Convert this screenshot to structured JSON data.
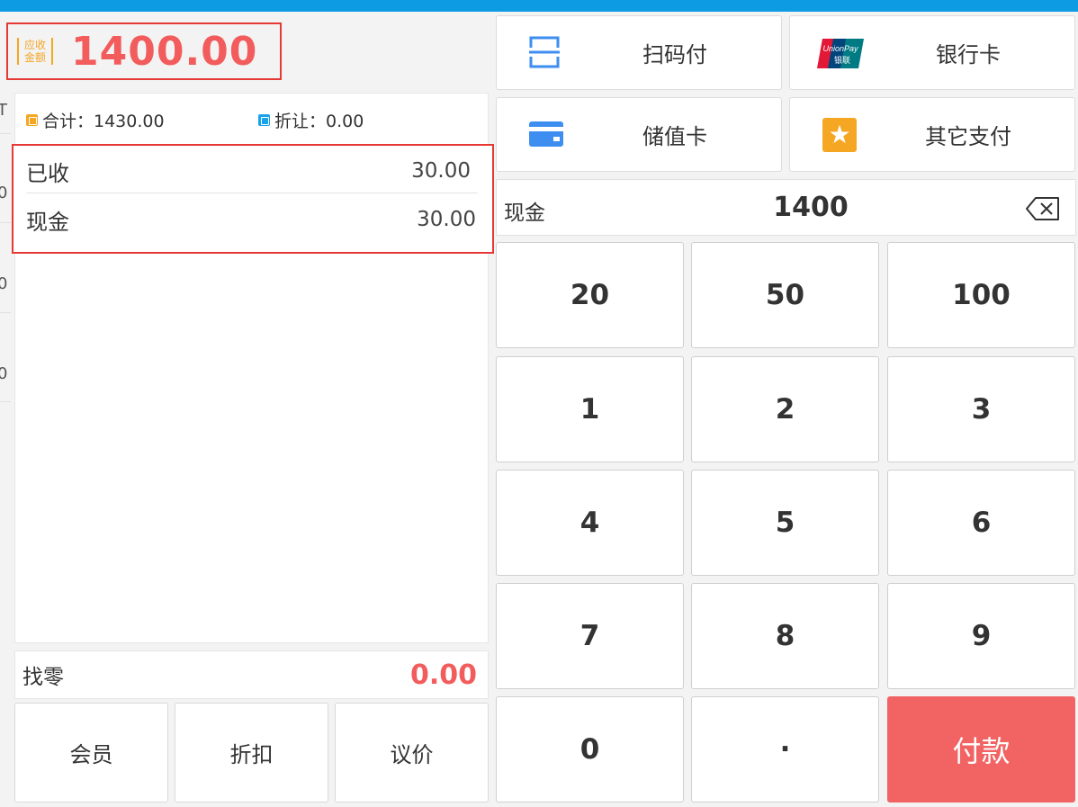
{
  "colors": {
    "accent_blue": "#0d9be3",
    "red": "#f25c5c",
    "orange": "#f5a623",
    "pay_button": "#f26363"
  },
  "left_edge_fragments": [
    "T",
    "0",
    "0",
    "0"
  ],
  "due": {
    "tag": "应收金额",
    "amount": "1400.00"
  },
  "summary": {
    "total_label": "合计：1430.00",
    "discount_label": "折让：0.00",
    "paid_rows": [
      {
        "label": "已收",
        "value": "30.00"
      },
      {
        "label": "现金",
        "value": "30.00"
      }
    ]
  },
  "change": {
    "label": "找零",
    "value": "0.00"
  },
  "actions": [
    "会员",
    "折扣",
    "议价"
  ],
  "payment_methods": [
    {
      "label": "扫码付",
      "icon": "scan-icon"
    },
    {
      "label": "银行卡",
      "icon": "unionpay-icon",
      "logo_text": "UnionPay",
      "logo_cn": "银联"
    },
    {
      "label": "储值卡",
      "icon": "card-icon"
    },
    {
      "label": "其它支付",
      "icon": "star-icon",
      "star": "★"
    }
  ],
  "input": {
    "label": "现金",
    "value": "1400",
    "backspace": "✕"
  },
  "keypad": [
    "20",
    "50",
    "100",
    "1",
    "2",
    "3",
    "4",
    "5",
    "6",
    "7",
    "8",
    "9",
    "0",
    "·",
    "付款"
  ]
}
